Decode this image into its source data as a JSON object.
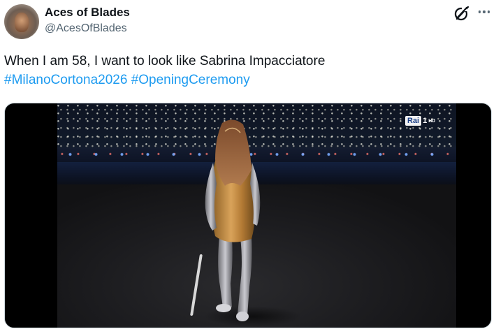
{
  "author": {
    "name": "Aces of Blades",
    "handle": "@AcesOfBlades",
    "avatar_icon": "profile-avatar"
  },
  "header_actions": {
    "grok_icon": "grok-icon",
    "more_icon": "more-icon"
  },
  "tweet": {
    "text": "When I am 58, I want to look like Sabrina Impacciatore",
    "hashtags": [
      "#MilanoCortona2026",
      "#OpeningCeremony"
    ]
  },
  "media": {
    "broadcaster_logo": "Rai",
    "channel": "1",
    "quality": "HD"
  },
  "colors": {
    "hashtag": "#1d9bf0",
    "secondary_text": "#536471",
    "primary_text": "#0f1419"
  }
}
